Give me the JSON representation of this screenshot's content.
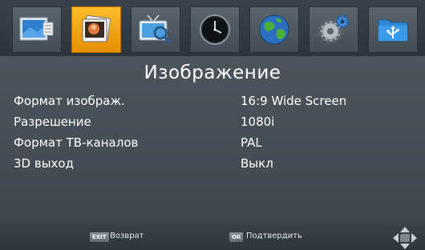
{
  "tabs": [
    {
      "icon": "picture-frame-icon"
    },
    {
      "icon": "image-icon",
      "active": true
    },
    {
      "icon": "tv-search-icon"
    },
    {
      "icon": "clock-icon"
    },
    {
      "icon": "globe-icon"
    },
    {
      "icon": "gear-icon"
    },
    {
      "icon": "usb-folder-icon"
    }
  ],
  "title": "Изображение",
  "settings": [
    {
      "label": "Формат изображ.",
      "value": "16:9 Wide Screen"
    },
    {
      "label": "Разрешение",
      "value": "1080i"
    },
    {
      "label": "Формат ТВ-каналов",
      "value": "PAL"
    },
    {
      "label": "3D выход",
      "value": "Выкл"
    }
  ],
  "footer": {
    "exit_key": "EXIT",
    "exit_label": "Возврат",
    "ok_key": "OK",
    "ok_label": "Подтвердить"
  },
  "colors": {
    "active_tab": "#f5a30f",
    "background": "#474f55",
    "text": "#ffffff"
  }
}
